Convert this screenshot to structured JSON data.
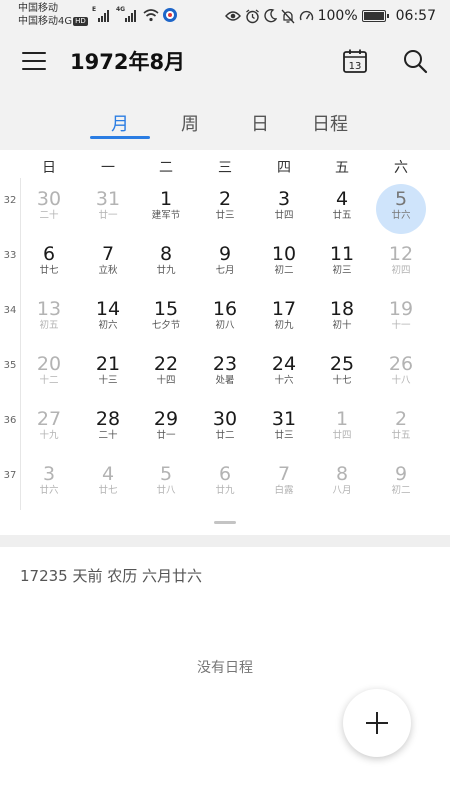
{
  "status_bar": {
    "carrier_line1": "中国移动",
    "carrier_line2": "中国移动4G",
    "hd_badge": "HD",
    "signal_label_1": "E",
    "signal_label_2": "4G",
    "battery_percent": "100%",
    "time": "06:57"
  },
  "header": {
    "title": "1972年8月",
    "today_badge": "13"
  },
  "tabs": [
    {
      "label": "月",
      "active": true
    },
    {
      "label": "周",
      "active": false
    },
    {
      "label": "日",
      "active": false
    },
    {
      "label": "日程",
      "active": false
    }
  ],
  "weekdays": [
    "日",
    "一",
    "二",
    "三",
    "四",
    "五",
    "六"
  ],
  "weeks": [
    {
      "number": "32",
      "days": [
        {
          "day": "30",
          "lunar": "二十",
          "muted": true
        },
        {
          "day": "31",
          "lunar": "廿一",
          "muted": true
        },
        {
          "day": "1",
          "lunar": "建军节",
          "muted": false
        },
        {
          "day": "2",
          "lunar": "廿三",
          "muted": false
        },
        {
          "day": "3",
          "lunar": "廿四",
          "muted": false
        },
        {
          "day": "4",
          "lunar": "廿五",
          "muted": false
        },
        {
          "day": "5",
          "lunar": "廿六",
          "muted": false,
          "selected": true
        }
      ]
    },
    {
      "number": "33",
      "days": [
        {
          "day": "6",
          "lunar": "廿七",
          "muted": false
        },
        {
          "day": "7",
          "lunar": "立秋",
          "muted": false
        },
        {
          "day": "8",
          "lunar": "廿九",
          "muted": false
        },
        {
          "day": "9",
          "lunar": "七月",
          "muted": false
        },
        {
          "day": "10",
          "lunar": "初二",
          "muted": false
        },
        {
          "day": "11",
          "lunar": "初三",
          "muted": false
        },
        {
          "day": "12",
          "lunar": "初四",
          "muted": true
        }
      ]
    },
    {
      "number": "34",
      "days": [
        {
          "day": "13",
          "lunar": "初五",
          "muted": true
        },
        {
          "day": "14",
          "lunar": "初六",
          "muted": false
        },
        {
          "day": "15",
          "lunar": "七夕节",
          "muted": false
        },
        {
          "day": "16",
          "lunar": "初八",
          "muted": false
        },
        {
          "day": "17",
          "lunar": "初九",
          "muted": false
        },
        {
          "day": "18",
          "lunar": "初十",
          "muted": false
        },
        {
          "day": "19",
          "lunar": "十一",
          "muted": true
        }
      ]
    },
    {
      "number": "35",
      "days": [
        {
          "day": "20",
          "lunar": "十二",
          "muted": true
        },
        {
          "day": "21",
          "lunar": "十三",
          "muted": false
        },
        {
          "day": "22",
          "lunar": "十四",
          "muted": false
        },
        {
          "day": "23",
          "lunar": "处暑",
          "muted": false
        },
        {
          "day": "24",
          "lunar": "十六",
          "muted": false
        },
        {
          "day": "25",
          "lunar": "十七",
          "muted": false
        },
        {
          "day": "26",
          "lunar": "十八",
          "muted": true
        }
      ]
    },
    {
      "number": "36",
      "days": [
        {
          "day": "27",
          "lunar": "十九",
          "muted": true
        },
        {
          "day": "28",
          "lunar": "二十",
          "muted": false
        },
        {
          "day": "29",
          "lunar": "廿一",
          "muted": false
        },
        {
          "day": "30",
          "lunar": "廿二",
          "muted": false
        },
        {
          "day": "31",
          "lunar": "廿三",
          "muted": false
        },
        {
          "day": "1",
          "lunar": "廿四",
          "muted": true
        },
        {
          "day": "2",
          "lunar": "廿五",
          "muted": true
        }
      ]
    },
    {
      "number": "37",
      "days": [
        {
          "day": "3",
          "lunar": "廿六",
          "muted": true
        },
        {
          "day": "4",
          "lunar": "廿七",
          "muted": true
        },
        {
          "day": "5",
          "lunar": "廿八",
          "muted": true
        },
        {
          "day": "6",
          "lunar": "廿九",
          "muted": true
        },
        {
          "day": "7",
          "lunar": "白露",
          "muted": true
        },
        {
          "day": "8",
          "lunar": "八月",
          "muted": true
        },
        {
          "day": "9",
          "lunar": "初二",
          "muted": true
        }
      ]
    }
  ],
  "detail": {
    "info": "17235 天前  农历 六月廿六",
    "no_event": "没有日程"
  },
  "colors": {
    "accent": "#2b7de3",
    "selected_bg": "#cfe4fb",
    "header_bg": "#f2f2f2"
  },
  "icons": {
    "menu": "menu-icon",
    "today": "calendar-today-icon",
    "search": "search-icon",
    "add": "plus-icon"
  }
}
